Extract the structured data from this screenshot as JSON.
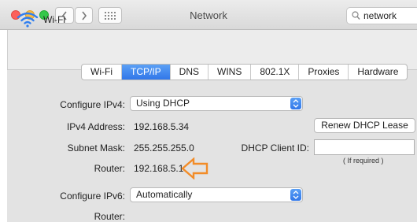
{
  "window": {
    "title": "Network"
  },
  "search": {
    "value": "network"
  },
  "interface": {
    "name": "Wi-Fi"
  },
  "tabs": [
    {
      "label": "Wi-Fi"
    },
    {
      "label": "TCP/IP",
      "active": true
    },
    {
      "label": "DNS"
    },
    {
      "label": "WINS"
    },
    {
      "label": "802.1X"
    },
    {
      "label": "Proxies"
    },
    {
      "label": "Hardware"
    }
  ],
  "ipv4": {
    "configure_label": "Configure IPv4:",
    "configure_value": "Using DHCP",
    "address_label": "IPv4 Address:",
    "address_value": "192.168.5.34",
    "subnet_label": "Subnet Mask:",
    "subnet_value": "255.255.255.0",
    "router_label": "Router:",
    "router_value": "192.168.5.1",
    "renew_button": "Renew DHCP Lease",
    "client_id_label": "DHCP Client ID:",
    "client_id_value": "",
    "client_id_hint": "( If required )"
  },
  "ipv6": {
    "configure_label": "Configure IPv6:",
    "configure_value": "Automatically",
    "router_label": "Router:"
  },
  "colors": {
    "accent": "#3177e9",
    "annotation_arrow": "#f28c28"
  }
}
